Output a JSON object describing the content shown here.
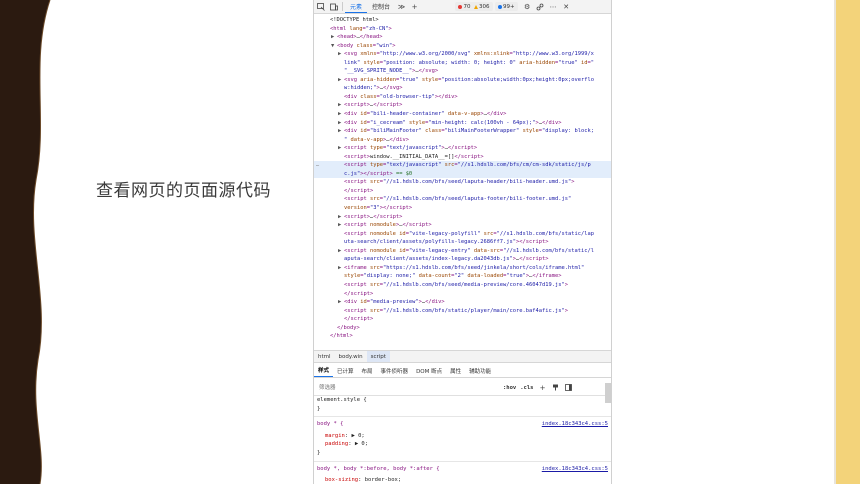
{
  "caption": "查看网页的页面源代码",
  "toolbar": {
    "tabs": [
      "元素",
      "控制台"
    ],
    "errors": "70",
    "warnings": "306",
    "info": "99+",
    "colors": {
      "error": "#e53935",
      "warning": "#f0a500",
      "info": "#1a73e8"
    }
  },
  "dom_lines": [
    {
      "indent": 0,
      "arrow": "",
      "html": "<span class='txt'>&lt;!DOCTYPE html&gt;</span>"
    },
    {
      "indent": 0,
      "arrow": "",
      "html": "<span class='tag'>&lt;html</span> <span class='attr'>lang</span>=<span class='val'>\"zh-CN\"</span><span class='tag'>&gt;</span>"
    },
    {
      "indent": 1,
      "arrow": "▶",
      "html": "<span class='tag'>&lt;head&gt;</span><span class='txt'>…</span><span class='tag'>&lt;/head&gt;</span>"
    },
    {
      "indent": 1,
      "arrow": "▼",
      "html": "<span class='tag'>&lt;body</span> <span class='attr'>class</span>=<span class='val'>\"win\"</span><span class='tag'>&gt;</span>"
    },
    {
      "indent": 2,
      "arrow": "▶",
      "html": "<span class='tag'>&lt;svg</span> <span class='attr'>xmlns</span>=<span class='val'>\"http://www.w3.org/2000/svg\"</span> <span class='attr'>xmlns:xlink</span>=<span class='val'>\"http://www.w3.org/1999/x</span>"
    },
    {
      "indent": 2,
      "arrow": "",
      "html": "<span class='val'>link\"</span> <span class='attr'>style</span>=<span class='val'>\"position: absolute; width: 0; height: 0\"</span> <span class='attr'>aria-hidden</span>=<span class='val'>\"true\"</span> <span class='attr'>id</span>=<span class='val'>\"</span>"
    },
    {
      "indent": 2,
      "arrow": "",
      "html": "<span class='val'>\"__SVG_SPRITE_NODE__\"</span><span class='tag'>&gt;</span><span class='txt'>…</span><span class='tag'>&lt;/svg&gt;</span>"
    },
    {
      "indent": 2,
      "arrow": "▶",
      "html": "<span class='tag'>&lt;svg</span> <span class='attr'>aria-hidden</span>=<span class='val'>\"true\"</span> <span class='attr'>style</span>=<span class='val'>\"position:absolute;width:0px;height:0px;overflo</span>"
    },
    {
      "indent": 2,
      "arrow": "",
      "html": "<span class='val'>w:hidden;\"</span><span class='tag'>&gt;</span><span class='txt'>…</span><span class='tag'>&lt;/svg&gt;</span>"
    },
    {
      "indent": 2,
      "arrow": "",
      "html": "<span class='tag'>&lt;div</span> <span class='attr'>class</span>=<span class='val'>\"old-browser-tip\"</span><span class='tag'>&gt;&lt;/div&gt;</span>"
    },
    {
      "indent": 2,
      "arrow": "▶",
      "html": "<span class='tag'>&lt;script&gt;</span><span class='txt'>…</span><span class='tag'>&lt;/script&gt;</span>"
    },
    {
      "indent": 2,
      "arrow": "▶",
      "html": "<span class='tag'>&lt;div</span> <span class='attr'>id</span>=<span class='val'>\"bili-header-container\"</span> <span class='attr'>data-v-app</span><span class='tag'>&gt;</span><span class='txt'>…</span><span class='tag'>&lt;/div&gt;</span>"
    },
    {
      "indent": 2,
      "arrow": "▶",
      "html": "<span class='tag'>&lt;div</span> <span class='attr'>id</span>=<span class='val'>\"i_cecream\"</span> <span class='attr'>style</span>=<span class='val'>\"min-height: calc(100vh - 64px);\"</span><span class='tag'>&gt;</span><span class='txt'>…</span><span class='tag'>&lt;/div&gt;</span>"
    },
    {
      "indent": 2,
      "arrow": "▶",
      "html": "<span class='tag'>&lt;div</span> <span class='attr'>id</span>=<span class='val'>\"biliMainFooter\"</span> <span class='attr'>class</span>=<span class='val'>\"biliMainFooterWrapper\"</span> <span class='attr'>style</span>=<span class='val'>\"display: block;</span>"
    },
    {
      "indent": 2,
      "arrow": "",
      "html": "<span class='val'>\"</span> <span class='attr'>data-v-app</span><span class='tag'>&gt;</span><span class='txt'>…</span><span class='tag'>&lt;/div&gt;</span>"
    },
    {
      "indent": 2,
      "arrow": "▶",
      "html": "<span class='tag'>&lt;script</span> <span class='attr'>type</span>=<span class='val'>\"text/javascript\"</span><span class='tag'>&gt;</span><span class='txt'>…</span><span class='tag'>&lt;/script&gt;</span>"
    },
    {
      "indent": 2,
      "arrow": "",
      "html": "<span class='tag'>&lt;script&gt;</span><span class='txt'>window.__INITIAL_DATA__=[]</span><span class='tag'>&lt;/script&gt;</span>"
    },
    {
      "indent": 2,
      "arrow": "",
      "sel": true,
      "html": "<span class='tag'>&lt;script</span> <span class='attr'>type</span>=<span class='val'>\"text/javascript\"</span> <span class='attr'>src</span>=<span class='val'>\"//s1.hdslb.com/bfs/cm/cm-sdk/static/js/p</span>"
    },
    {
      "indent": 2,
      "arrow": "",
      "sel": true,
      "html": "<span class='val'>c.js\"</span><span class='tag'>&gt;&lt;/script&gt;</span> <span class='cmt'>== $0</span>"
    },
    {
      "indent": 2,
      "arrow": "",
      "html": "<span class='tag'>&lt;script</span> <span class='attr'>src</span>=<span class='val'>\"//s1.hdslb.com/bfs/seed/laputa-header/bili-header.umd.js\"</span><span class='tag'>&gt;</span>"
    },
    {
      "indent": 2,
      "arrow": "",
      "html": "<span class='tag'>&lt;/script&gt;</span>"
    },
    {
      "indent": 2,
      "arrow": "",
      "html": "<span class='tag'>&lt;script</span> <span class='attr'>src</span>=<span class='val'>\"//s1.hdslb.com/bfs/seed/laputa-footer/bili-footer.umd.js\"</span>"
    },
    {
      "indent": 2,
      "arrow": "",
      "html": "<span class='attr'>version</span>=<span class='val'>\"3\"</span><span class='tag'>&gt;&lt;/script&gt;</span>"
    },
    {
      "indent": 2,
      "arrow": "▶",
      "html": "<span class='tag'>&lt;script&gt;</span><span class='txt'>…</span><span class='tag'>&lt;/script&gt;</span>"
    },
    {
      "indent": 2,
      "arrow": "▶",
      "html": "<span class='tag'>&lt;script</span> <span class='attr'>nomodule</span><span class='tag'>&gt;</span><span class='txt'>…</span><span class='tag'>&lt;/script&gt;</span>"
    },
    {
      "indent": 2,
      "arrow": "",
      "html": "<span class='tag'>&lt;script</span> <span class='attr'>nomodule</span> <span class='attr'>id</span>=<span class='val'>\"vite-legacy-polyfill\"</span> <span class='attr'>src</span>=<span class='val'>\"//s1.hdslb.com/bfs/static/lap</span>"
    },
    {
      "indent": 2,
      "arrow": "",
      "html": "<span class='val'>uta-search/client/assets/polyfills-legacy.2686ff7.js\"</span><span class='tag'>&gt;&lt;/script&gt;</span>"
    },
    {
      "indent": 2,
      "arrow": "▶",
      "html": "<span class='tag'>&lt;script</span> <span class='attr'>nomodule</span> <span class='attr'>id</span>=<span class='val'>\"vite-legacy-entry\"</span> <span class='attr'>data-src</span>=<span class='val'>\"//s1.hdslb.com/bfs/static/l</span>"
    },
    {
      "indent": 2,
      "arrow": "",
      "html": "<span class='val'>aputa-search/client/assets/index-legacy.da2043db.js\"</span><span class='tag'>&gt;</span><span class='txt'>…</span><span class='tag'>&lt;/script&gt;</span>"
    },
    {
      "indent": 2,
      "arrow": "▶",
      "html": "<span class='tag'>&lt;iframe</span> <span class='attr'>src</span>=<span class='val'>\"https://s1.hdslb.com/bfs/seed/jinkela/short/cols/iframe.html\"</span>"
    },
    {
      "indent": 2,
      "arrow": "",
      "html": "<span class='attr'>style</span>=<span class='val'>\"display: none;\"</span> <span class='attr'>data-count</span>=<span class='val'>\"2\"</span> <span class='attr'>data-loaded</span>=<span class='val'>\"true\"</span><span class='tag'>&gt;</span><span class='txt'>…</span><span class='tag'>&lt;/iframe&gt;</span>"
    },
    {
      "indent": 2,
      "arrow": "",
      "html": "<span class='tag'>&lt;script</span> <span class='attr'>src</span>=<span class='val'>\"//s1.hdslb.com/bfs/seed/media-preview/core.46047d19.js\"</span><span class='tag'>&gt;</span>"
    },
    {
      "indent": 2,
      "arrow": "",
      "html": "<span class='tag'>&lt;/script&gt;</span>"
    },
    {
      "indent": 2,
      "arrow": "▶",
      "html": "<span class='tag'>&lt;div</span> <span class='attr'>id</span>=<span class='val'>\"media-preview\"</span><span class='tag'>&gt;</span><span class='txt'>…</span><span class='tag'>&lt;/div&gt;</span>"
    },
    {
      "indent": 2,
      "arrow": "",
      "html": "<span class='tag'>&lt;script</span> <span class='attr'>src</span>=<span class='val'>\"//s1.hdslb.com/bfs/static/player/main/core.baf4afic.js\"</span><span class='tag'>&gt;</span>"
    },
    {
      "indent": 2,
      "arrow": "",
      "html": "<span class='tag'>&lt;/script&gt;</span>"
    },
    {
      "indent": 1,
      "arrow": "",
      "html": "<span class='tag'>&lt;/body&gt;</span>"
    },
    {
      "indent": 0,
      "arrow": "",
      "html": "<span class='tag'>&lt;/html&gt;</span>"
    }
  ],
  "gutter_mark": "…",
  "breadcrumbs": [
    "html",
    "body.win",
    "script"
  ],
  "subtabs": [
    "样式",
    "已计算",
    "布局",
    "事件侦听器",
    "DOM 断点",
    "属性",
    "辅助功能"
  ],
  "filter": {
    "placeholder": "筛选器",
    "hov": ":hov",
    "cls": ".cls"
  },
  "styles": {
    "element_style": "element.style {",
    "close": "}",
    "rule1_selector": "body * {",
    "rule1_source": "index.18c343c4.css:5",
    "rule1_props": [
      {
        "name": "margin",
        "value": "▶ 0;"
      },
      {
        "name": "padding",
        "value": "▶ 0;"
      }
    ],
    "rule2_selector": "body *, body *:before, body *:after {",
    "rule2_source": "index.18c343c4.css:5",
    "rule2_props": [
      {
        "name": "box-sizing",
        "value": "border-box;"
      }
    ]
  }
}
